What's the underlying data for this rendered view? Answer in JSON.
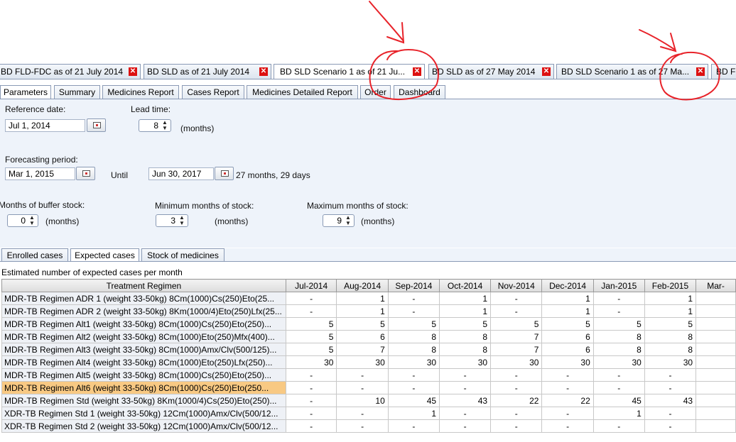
{
  "doc_tabs": [
    {
      "label": "BD FLD-FDC as of 21 July 2014",
      "active": false
    },
    {
      "label": "BD SLD as of 21 July 2014",
      "active": false
    },
    {
      "label": "BD SLD Scenario 1 as of 21 Ju...",
      "active": true
    },
    {
      "label": "BD SLD as of 27 May 2014",
      "active": false
    },
    {
      "label": "BD SLD Scenario 1 as of 27 Ma...",
      "active": false
    },
    {
      "label": "BD F",
      "active": false
    }
  ],
  "close_glyph": "✕",
  "main_tabs": [
    "Parameters",
    "Summary",
    "Medicines Report",
    "Cases Report",
    "Medicines Detailed Report",
    "Order",
    "Dashboard"
  ],
  "params": {
    "reference_date_label": "Reference date:",
    "reference_date": "Jul 1, 2014",
    "lead_time_label": "Lead time:",
    "lead_time": "8",
    "lead_time_unit": "(months)",
    "forecasting_period_label": "Forecasting period:",
    "forecast_start": "Mar 1, 2015",
    "until_label": "Until",
    "forecast_end": "Jun 30, 2017",
    "duration": "27 months, 29  days",
    "buffer_label": "Months of buffer stock:",
    "buffer_value": "0",
    "buffer_unit": "(months)",
    "min_label": "Minimum months of stock:",
    "min_value": "3",
    "min_unit": "(months)",
    "max_label": "Maximum months of stock:",
    "max_value": "9",
    "max_unit": "(months)"
  },
  "lower_tabs": [
    "Enrolled cases",
    "Expected cases",
    "Stock of medicines"
  ],
  "table": {
    "caption": "Estimated number of expected cases per month",
    "headers": [
      "Treatment Regimen",
      "Jul-2014",
      "Aug-2014",
      "Sep-2014",
      "Oct-2014",
      "Nov-2014",
      "Dec-2014",
      "Jan-2015",
      "Feb-2015",
      "Mar-"
    ],
    "rows": [
      [
        "MDR-TB Regimen ADR 1 (weight 33-50kg)  8Cm(1000)Cs(250)Eto(25...",
        "-",
        "1",
        "-",
        "1",
        "-",
        "1",
        "-",
        "1",
        ""
      ],
      [
        "MDR-TB Regimen ADR 2 (weight 33-50kg)  8Km(1000/4)Eto(250)Lfx(25...",
        "-",
        "1",
        "-",
        "1",
        "-",
        "1",
        "-",
        "1",
        ""
      ],
      [
        "MDR-TB Regimen Alt1 (weight 33-50kg)  8Cm(1000)Cs(250)Eto(250)...",
        "5",
        "5",
        "5",
        "5",
        "5",
        "5",
        "5",
        "5",
        ""
      ],
      [
        "MDR-TB Regimen Alt2 (weight 33-50kg)  8Cm(1000)Eto(250)Mfx(400)...",
        "5",
        "6",
        "8",
        "8",
        "7",
        "6",
        "8",
        "8",
        ""
      ],
      [
        "MDR-TB Regimen Alt3 (weight 33-50kg)  8Cm(1000)Amx/Clv(500/125)...",
        "5",
        "7",
        "8",
        "8",
        "7",
        "6",
        "8",
        "8",
        ""
      ],
      [
        "MDR-TB Regimen Alt4 (weight 33-50kg)  8Cm(1000)Eto(250)Lfx(250)...",
        "30",
        "30",
        "30",
        "30",
        "30",
        "30",
        "30",
        "30",
        ""
      ],
      [
        "MDR-TB Regimen Alt5 (weight 33-50kg)    8Cm(1000)Cs(250)Eto(250)...",
        "-",
        "-",
        "-",
        "-",
        "-",
        "-",
        "-",
        "-",
        ""
      ],
      [
        "MDR-TB Regimen Alt6 (weight 33-50kg)    8Cm(1000)Cs(250)Eto(250...",
        "-",
        "-",
        "-",
        "-",
        "-",
        "-",
        "-",
        "-",
        ""
      ],
      [
        "MDR-TB Regimen Std (weight 33-50kg)  8Km(1000/4)Cs(250)Eto(250)...",
        "-",
        "10",
        "45",
        "43",
        "22",
        "22",
        "45",
        "43",
        ""
      ],
      [
        "XDR-TB Regimen Std 1 (weight 33-50kg)  12Cm(1000)Amx/Clv(500/12...",
        "-",
        "-",
        "1",
        "-",
        "-",
        "-",
        "1",
        "-",
        ""
      ],
      [
        "XDR-TB Regimen Std 2 (weight 33-50kg)  12Cm(1000)Amx/Clv(500/12...",
        "-",
        "-",
        "-",
        "-",
        "-",
        "-",
        "-",
        "-",
        ""
      ]
    ],
    "selected_row": 7
  },
  "colors": {
    "annotation_red": "#e8232a",
    "selected_row": "#f8c983",
    "panel_bg": "#eef3fa"
  }
}
